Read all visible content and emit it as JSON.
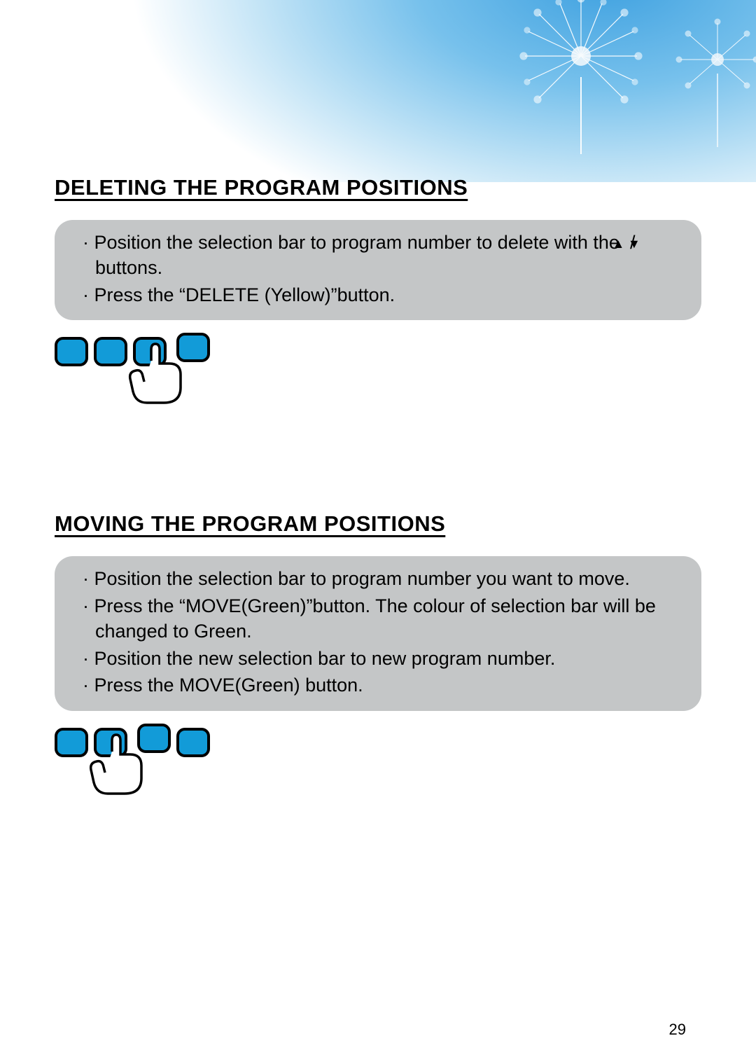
{
  "header_image_alt": "Sky with dandelions",
  "sections": [
    {
      "heading": "DELETING THE PROGRAM POSITIONS",
      "lines": [
        {
          "prefix": "· Position the selection bar to program number to delete with the",
          "arrows": true,
          "suffix": " buttons."
        },
        {
          "prefix": "· Press the “DELETE (Yellow)”button.",
          "arrows": false,
          "suffix": ""
        }
      ],
      "pressed_index": 2
    },
    {
      "heading": "MOVING THE PROGRAM POSITIONS",
      "lines": [
        {
          "prefix": "· Position the selection bar to program number you want to move.",
          "arrows": false,
          "suffix": ""
        },
        {
          "prefix": "· Press the “MOVE(Green)”button. The colour of selection bar will be changed to Green.",
          "arrows": false,
          "suffix": ""
        },
        {
          "prefix": "· Position the new selection bar to new program number.",
          "arrows": false,
          "suffix": ""
        },
        {
          "prefix": "· Press the MOVE(Green) button.",
          "arrows": false,
          "suffix": ""
        }
      ],
      "pressed_index": 1
    }
  ],
  "page_number": "29",
  "arrow_up": "▲",
  "arrow_down": "▼",
  "slash": " / "
}
